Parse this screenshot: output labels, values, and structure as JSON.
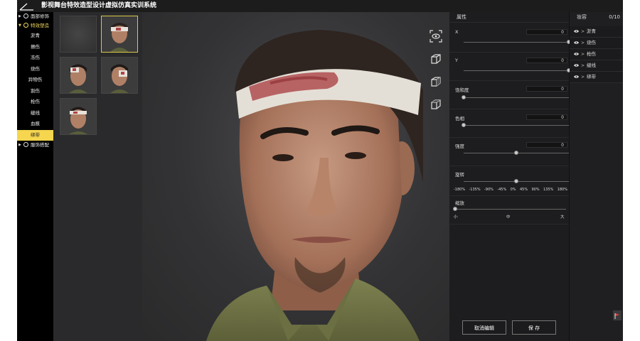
{
  "app": {
    "title": "影视舞台特效造型设计虚拟仿真实训系统"
  },
  "sidebar": {
    "categories": [
      {
        "label": "面部修饰",
        "arrow": "▶",
        "active": false
      },
      {
        "label": "特效塑造",
        "arrow": "▼",
        "active": true
      },
      {
        "label": "服饰搭配",
        "arrow": "▶",
        "active": false
      }
    ],
    "subitems": [
      "淤青",
      "擦伤",
      "冻伤",
      "烧伤",
      "异物伤",
      "割伤",
      "枪伤",
      "缝线",
      "血痕",
      "绑带"
    ],
    "selected_subitem": "绑带"
  },
  "thumbnails": [
    {
      "name": "empty",
      "selected": false
    },
    {
      "name": "bandage-head-1",
      "selected": true
    },
    {
      "name": "bandage-head-2",
      "selected": false
    },
    {
      "name": "bandage-head-3",
      "selected": false
    },
    {
      "name": "bandage-head-4",
      "selected": false
    }
  ],
  "viewport_tools": [
    "focus-eye-icon",
    "cube-front-icon",
    "cube-side-icon",
    "cube-top-icon"
  ],
  "attributes": {
    "header": "属性",
    "x": {
      "label": "X",
      "value": "0",
      "level": 1.0
    },
    "y": {
      "label": "Y",
      "value": "0",
      "level": 1.0
    },
    "saturation": {
      "label": "饱和度",
      "value": "0",
      "level": 0.0
    },
    "hue": {
      "label": "色相",
      "value": "0",
      "level": 0.0
    },
    "intensity": {
      "label": "强度",
      "value": "0",
      "level": 0.5
    },
    "rotation": {
      "label": "旋转",
      "level": 0.5,
      "ticks": [
        "-180%",
        "-135%",
        "-90%",
        "-45%",
        "0%",
        "45%",
        "90%",
        "135%",
        "180%"
      ]
    },
    "scale": {
      "label": "缩放",
      "level": 0.0,
      "ticks": [
        "小",
        "中",
        "大"
      ]
    }
  },
  "layers": {
    "header": "妆容",
    "count": "0/10",
    "items": [
      "淤青",
      "烧伤",
      "枪伤",
      "缝线",
      "绑带"
    ]
  },
  "buttons": {
    "cancel": "取消编辑",
    "save": "保 存"
  },
  "colors": {
    "accent": "#f5d64e",
    "background": "#2a2a2c",
    "panel": "#1e1e20"
  }
}
